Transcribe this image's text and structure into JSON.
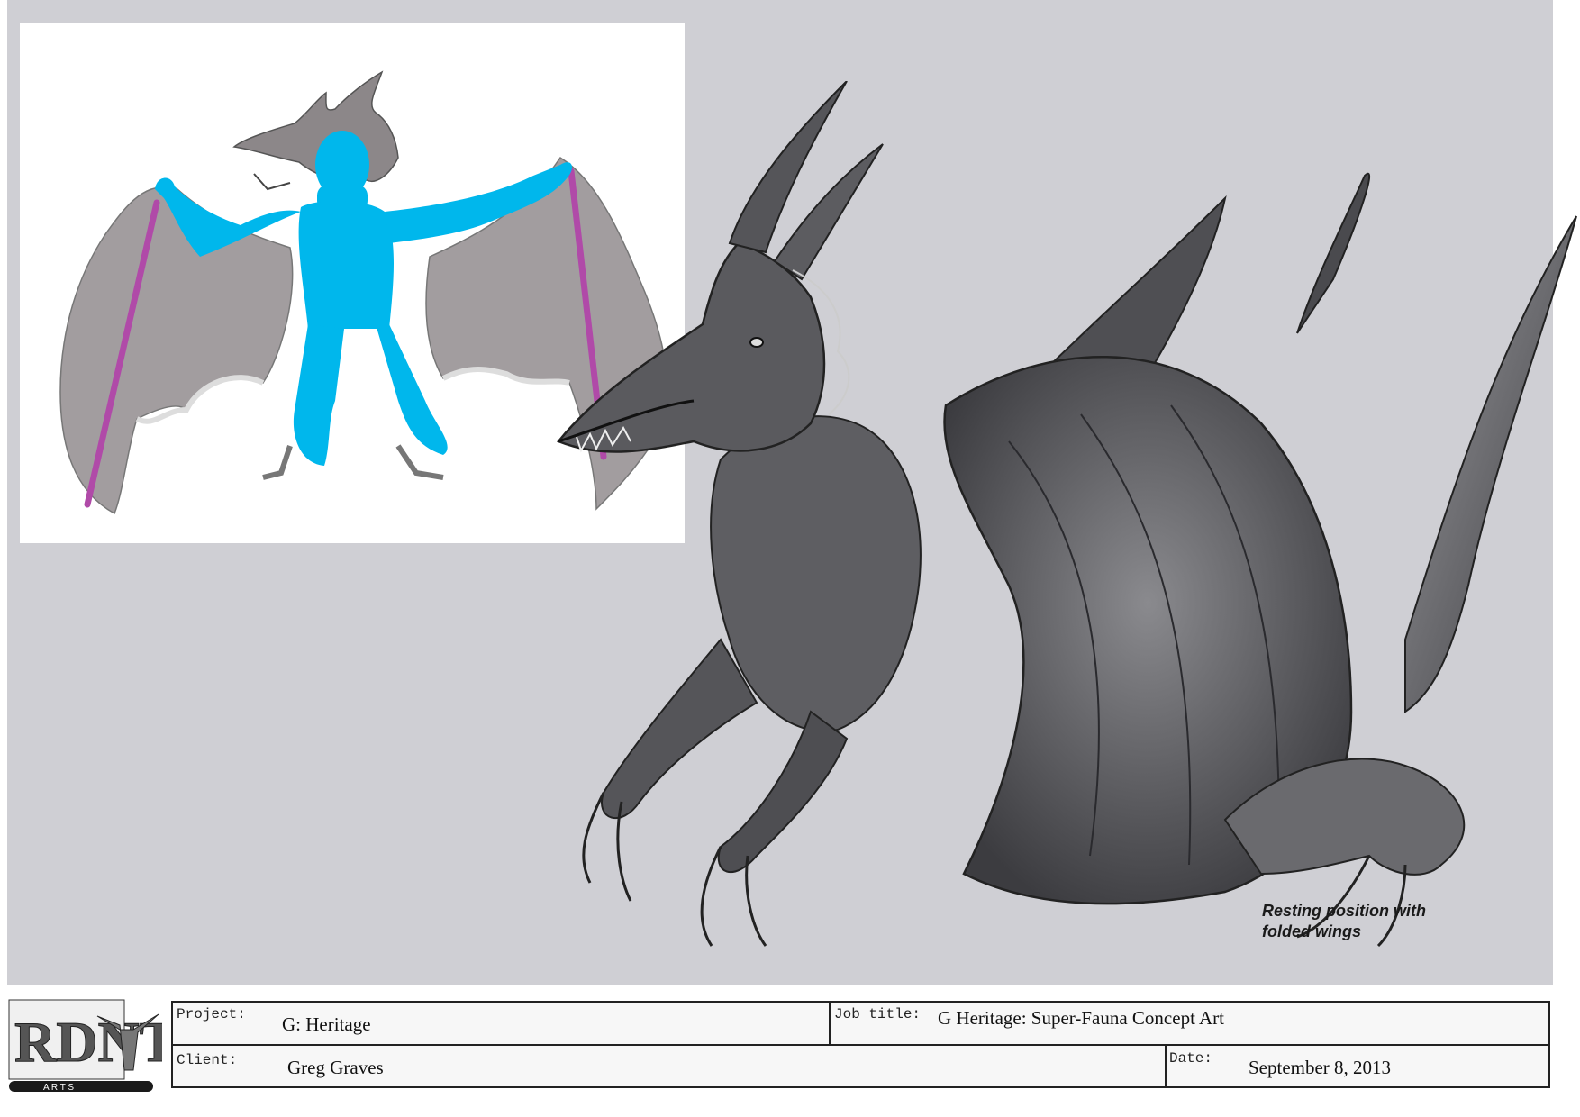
{
  "caption": {
    "line1": "Resting position with",
    "line2": "folded wings"
  },
  "title_block": {
    "project_label": "Project:",
    "project_value": "G: Heritage",
    "job_title_label": "Job title:",
    "job_title_value": "G Heritage: Super-Fauna Concept Art",
    "client_label": "Client:",
    "client_value": "Greg Graves",
    "date_label": "Date:",
    "date_value": "September 8, 2013"
  },
  "logo": {
    "letters": "RDNT",
    "subtext": "A R T S"
  },
  "colors": {
    "canvas": "#cfcfd4",
    "human_overlay": "#00b7ec",
    "wing_strut": "#b04aa8",
    "wing_membrane": "#9a9597",
    "dragon_body": "#5a5a5e"
  }
}
